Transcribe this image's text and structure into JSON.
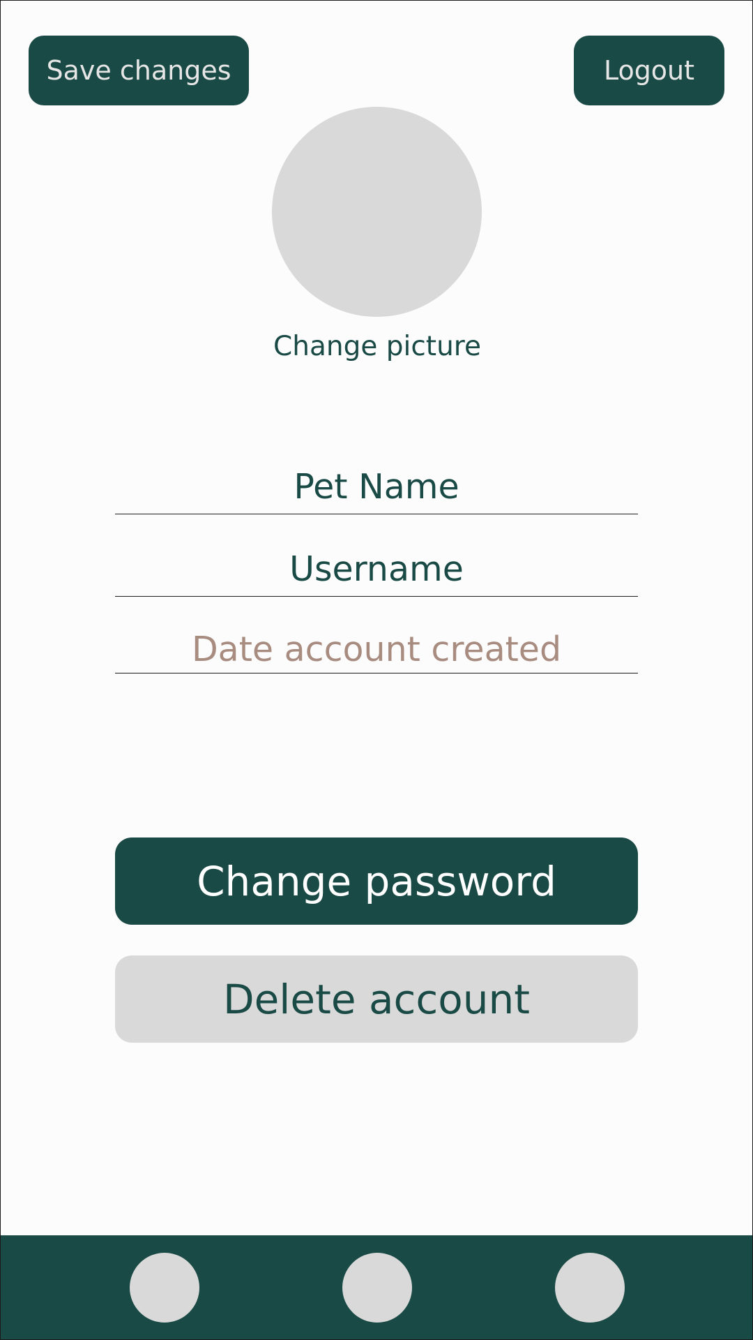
{
  "header": {
    "save_label": "Save changes",
    "logout_label": "Logout"
  },
  "profile": {
    "change_picture_label": "Change picture"
  },
  "fields": {
    "pet_name": "Pet Name",
    "username": "Username",
    "date_created_placeholder": "Date account created"
  },
  "actions": {
    "change_password_label": "Change password",
    "delete_account_label": "Delete account"
  },
  "nav": {
    "items": [
      {
        "icon": "nav-circle-icon"
      },
      {
        "icon": "nav-circle-icon"
      },
      {
        "icon": "nav-circle-icon"
      }
    ]
  },
  "colors": {
    "primary": "#1a4a45",
    "primary_text": "#e6e6e6",
    "neutral": "#d9d9d9",
    "text_dark": "#1a4a45",
    "placeholder": "#a98c80",
    "background": "#fcfcfc"
  }
}
